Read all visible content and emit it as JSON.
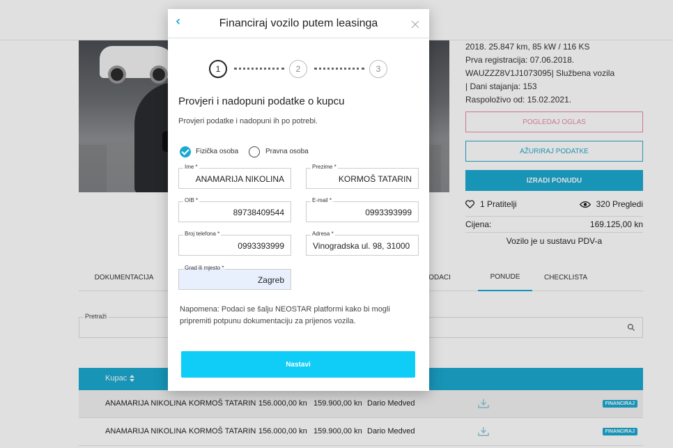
{
  "background": {
    "car_info_lines": [
      "2018. 25.847 km, 85 kW / 116 KS",
      "Prva registracija: 07.06.2018.",
      "WAUZZZ8V1J1073095| Službena vozila",
      "| Dani stajanja: 153",
      "Raspoloživo od: 15.02.2021."
    ],
    "buttons": {
      "view_ad": "POGLEDAJ OGLAS",
      "update_data": "AŽURIRAJ PODATKE",
      "create_offer": "IZRADI PONUDU"
    },
    "followers": "1 Pratitelji",
    "views": "320 Pregledi",
    "price_label": "Cijena:",
    "price_value": "169.125,00 kn",
    "vat_note": "Vozilo je u sustavu PDV-a",
    "tabs": [
      "DOKUMENTACIJA",
      "E I DODACI",
      "PONUDE",
      "CHECKLISTA"
    ],
    "search_label": "Pretraži",
    "table": {
      "header_buyer": "Kupac",
      "rows": [
        {
          "first": "ANAMARIJA NIKOLINA",
          "last": "KORMOŠ TATARIN",
          "amount1": "156.000,00 kn",
          "amount2": "159.900,00 kn",
          "agent": "Dario Medved",
          "badge": "FINANCIRAJ"
        },
        {
          "first": "ANAMARIJA NIKOLINA",
          "last": "KORMOŠ TATARIN",
          "amount1": "156.000,00 kn",
          "amount2": "159.900,00 kn",
          "agent": "Dario Medved",
          "badge": "FINANCIRAJ"
        }
      ]
    }
  },
  "modal": {
    "title": "Financiraj vozilo putem leasinga",
    "steps": [
      "1",
      "2",
      "3"
    ],
    "active_step": 1,
    "heading": "Provjeri i nadopuni podatke o kupcu",
    "subheading": "Provjeri podatke i nadopuni ih po potrebi.",
    "person_type": {
      "natural": "Fizička osoba",
      "legal": "Pravna osoba",
      "selected": "natural"
    },
    "fields": {
      "ime": {
        "label": "Ime *",
        "value": "ANAMARIJA NIKOLINA"
      },
      "prezime": {
        "label": "Prezime *",
        "value": "KORMOŠ TATARIN"
      },
      "oib": {
        "label": "OIB *",
        "value": "89738409544"
      },
      "email": {
        "label": "E-mail *",
        "value": "0993393999"
      },
      "phone": {
        "label": "Broj telefona *",
        "value": "0993393999"
      },
      "address": {
        "label": "Adresa *",
        "value": "Vinogradska ul. 98, 31000"
      },
      "city": {
        "label": "Grad ili mjesto *",
        "value": "Zagreb"
      }
    },
    "note": "Napomena: Podaci se šalju NEOSTAR platformi kako bi mogli pripremiti potpunu dokumentaciju za prijenos vozila.",
    "next_button": "Nastavi"
  },
  "colors": {
    "accent": "#1ba9d0",
    "button_cyan": "#0fcdf6",
    "pink": "#e58aa7"
  }
}
